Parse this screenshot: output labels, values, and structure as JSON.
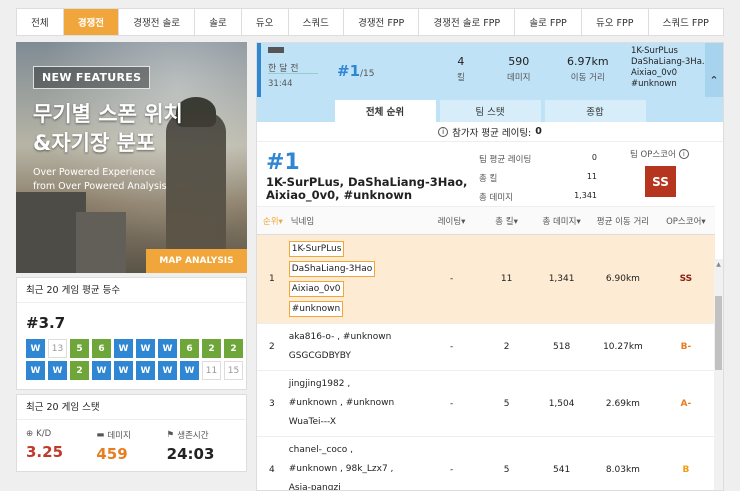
{
  "tabs": [
    "전체",
    "경쟁전",
    "경쟁전 솔로",
    "솔로",
    "듀오",
    "스쿼드",
    "경쟁전 FPP",
    "경쟁전 솔로 FPP",
    "솔로 FPP",
    "듀오 FPP",
    "스쿼드 FPP"
  ],
  "active_tab": "경쟁전",
  "banner": {
    "badge": "NEW FEATURES",
    "title_line1": "무기별 스폰 위치",
    "title_line2": "&자기장 분포",
    "sub_line1": "Over Powered Experience",
    "sub_line2": "from Over Powered Analysis",
    "cta": "MAP ANALYSIS"
  },
  "avg_rank": {
    "title": "최근 20 게임 평균 등수",
    "value": "#3.7",
    "results": [
      {
        "t": "W",
        "c": "W"
      },
      {
        "t": "13",
        "c": "N"
      },
      {
        "t": "5",
        "c": "G"
      },
      {
        "t": "6",
        "c": "G"
      },
      {
        "t": "W",
        "c": "W"
      },
      {
        "t": "W",
        "c": "W"
      },
      {
        "t": "W",
        "c": "W"
      },
      {
        "t": "6",
        "c": "G"
      },
      {
        "t": "2",
        "c": "G"
      },
      {
        "t": "2",
        "c": "G"
      },
      {
        "t": "W",
        "c": "W"
      },
      {
        "t": "W",
        "c": "W"
      },
      {
        "t": "2",
        "c": "G"
      },
      {
        "t": "W",
        "c": "W"
      },
      {
        "t": "W",
        "c": "W"
      },
      {
        "t": "W",
        "c": "W"
      },
      {
        "t": "W",
        "c": "W"
      },
      {
        "t": "W",
        "c": "W"
      },
      {
        "t": "11",
        "c": "N"
      },
      {
        "t": "15",
        "c": "N"
      }
    ]
  },
  "recent_stats": {
    "title": "최근 20 게임 스탯",
    "kd_label": "K/D",
    "kd_value": "3.25",
    "kd_color": "#c0392b",
    "dmg_label": "데미지",
    "dmg_value": "459",
    "dmg_color": "#e67e22",
    "surv_label": "생존시간",
    "surv_value": "24:03",
    "surv_color": "#222222"
  },
  "match": {
    "mode": "한 달 전",
    "time": "31:44",
    "placement": "#1",
    "placement_total": "/15",
    "kills": "4",
    "kills_label": "킬",
    "damage": "590",
    "damage_label": "데미지",
    "distance": "6.97km",
    "distance_label": "이동 거리",
    "team": [
      "1K-SurPLus",
      "DaShaLiang-3Ha...",
      "Aixiao_0v0",
      "#unknown"
    ],
    "expand_icon": "chevron-up"
  },
  "subtabs": [
    "전체 순위",
    "팀 스탯",
    "종합"
  ],
  "avg_rating": {
    "label": "참가자 평균 레이팅:",
    "value": "0"
  },
  "winner": {
    "rank": "#1",
    "names_line1": "1K-SurPLus, DaShaLiang-3Hao,",
    "names_line2": "Aixiao_0v0, #unknown",
    "team_rating_label": "팀 평균 레이팅",
    "team_rating": "0",
    "kills_label": "총 킬",
    "kills": "11",
    "dmg_label": "총 데미지",
    "dmg": "1,341",
    "op_label": "팀 OP스코어",
    "op_badge": "SS"
  },
  "table": {
    "headers": [
      "순위▾",
      "닉네임",
      "레이팅▾",
      "총 킬▾",
      "총 데미지▾",
      "평균 이동 거리",
      "OP스코어▾"
    ],
    "rows": [
      {
        "rank": "1",
        "names": [
          "1K-SurPLus",
          "DaShaLiang-3Hao",
          "Aixiao_0v0",
          "#unknown"
        ],
        "rating": "-",
        "kills": "11",
        "dmg": "1,341",
        "dist": "6.90km",
        "op": "SS",
        "op_color": "#8b1d0f"
      },
      {
        "rank": "2",
        "names": [
          "aka816-o- , #unknown",
          "GSGCGDBYBY"
        ],
        "rating": "-",
        "kills": "2",
        "dmg": "518",
        "dist": "10.27km",
        "op": "B-",
        "op_color": "#e67e22"
      },
      {
        "rank": "3",
        "names": [
          "jingjing1982 ,",
          "#unknown , #unknown",
          "WuaTei---X"
        ],
        "rating": "-",
        "kills": "5",
        "dmg": "1,504",
        "dist": "2.69km",
        "op": "A-",
        "op_color": "#e67e22"
      },
      {
        "rank": "4",
        "names": [
          "chanel-_coco ,",
          "#unknown , 98k_Lzx7 ,",
          "Asia-pangzi"
        ],
        "rating": "-",
        "kills": "5",
        "dmg": "541",
        "dist": "8.03km",
        "op": "B",
        "op_color": "#f39c12"
      }
    ]
  }
}
